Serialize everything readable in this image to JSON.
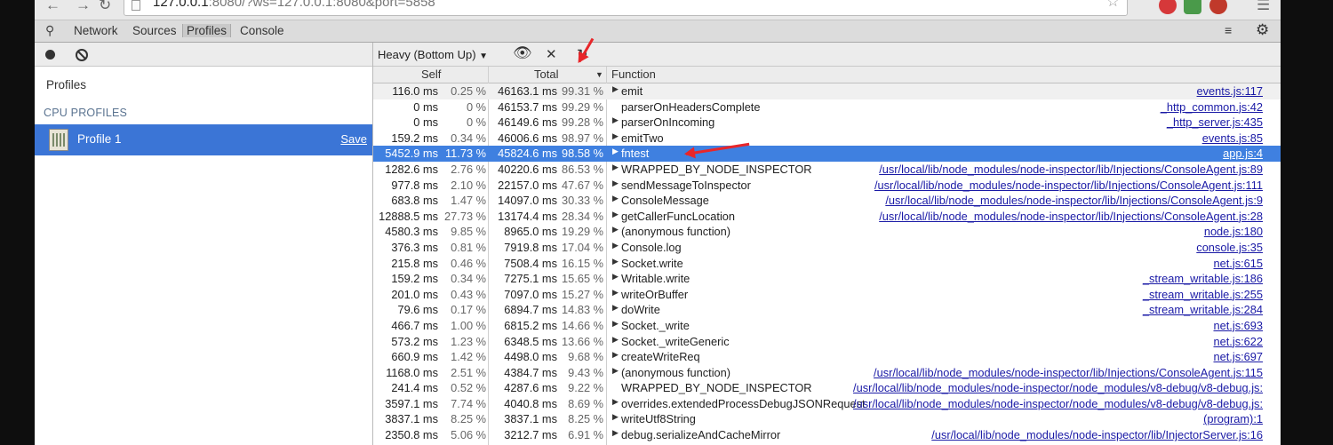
{
  "browser": {
    "url_prefix": "127.0.0.1",
    "url_rest": ":8080/?ws=127.0.0.1:8080&port=5858"
  },
  "devtools": {
    "tabs": [
      "Network",
      "Sources",
      "Profiles",
      "Console"
    ],
    "selected_tab": "Profiles"
  },
  "sidebar": {
    "title": "Profiles",
    "section": "CPU PROFILES",
    "profile_name": "Profile 1",
    "save_label": "Save"
  },
  "toolbar": {
    "view_mode": "Heavy (Bottom Up)"
  },
  "columns": {
    "self": "Self",
    "total": "Total",
    "function": "Function"
  },
  "rows": [
    {
      "self": "116.0 ms",
      "self_pct": "0.25 %",
      "total": "46163.1 ms",
      "total_pct": "99.31 %",
      "expand": true,
      "func": "emit",
      "url": "events.js:117"
    },
    {
      "self": "0 ms",
      "self_pct": "0 %",
      "total": "46153.7 ms",
      "total_pct": "99.29 %",
      "expand": false,
      "func": "parserOnHeadersComplete",
      "url": "_http_common.js:42"
    },
    {
      "self": "0 ms",
      "self_pct": "0 %",
      "total": "46149.6 ms",
      "total_pct": "99.28 %",
      "expand": true,
      "func": "parserOnIncoming",
      "url": "_http_server.js:435"
    },
    {
      "self": "159.2 ms",
      "self_pct": "0.34 %",
      "total": "46006.6 ms",
      "total_pct": "98.97 %",
      "expand": true,
      "func": "emitTwo",
      "url": "events.js:85"
    },
    {
      "self": "5452.9 ms",
      "self_pct": "11.73 %",
      "total": "45824.6 ms",
      "total_pct": "98.58 %",
      "expand": true,
      "func": "fntest",
      "url": "app.js:4",
      "selected": true
    },
    {
      "self": "1282.6 ms",
      "self_pct": "2.76 %",
      "total": "40220.6 ms",
      "total_pct": "86.53 %",
      "expand": true,
      "func": "WRAPPED_BY_NODE_INSPECTOR",
      "url": "/usr/local/lib/node_modules/node-inspector/lib/Injections/ConsoleAgent.js:89"
    },
    {
      "self": "977.8 ms",
      "self_pct": "2.10 %",
      "total": "22157.0 ms",
      "total_pct": "47.67 %",
      "expand": true,
      "func": "sendMessageToInspector",
      "url": "/usr/local/lib/node_modules/node-inspector/lib/Injections/ConsoleAgent.js:111"
    },
    {
      "self": "683.8 ms",
      "self_pct": "1.47 %",
      "total": "14097.0 ms",
      "total_pct": "30.33 %",
      "expand": true,
      "func": "ConsoleMessage",
      "url": "/usr/local/lib/node_modules/node-inspector/lib/Injections/ConsoleAgent.js:9"
    },
    {
      "self": "12888.5 ms",
      "self_pct": "27.73 %",
      "total": "13174.4 ms",
      "total_pct": "28.34 %",
      "expand": true,
      "func": "getCallerFuncLocation",
      "url": "/usr/local/lib/node_modules/node-inspector/lib/Injections/ConsoleAgent.js:28"
    },
    {
      "self": "4580.3 ms",
      "self_pct": "9.85 %",
      "total": "8965.0 ms",
      "total_pct": "19.29 %",
      "expand": true,
      "func": "(anonymous function)",
      "url": "node.js:180"
    },
    {
      "self": "376.3 ms",
      "self_pct": "0.81 %",
      "total": "7919.8 ms",
      "total_pct": "17.04 %",
      "expand": true,
      "func": "Console.log",
      "url": "console.js:35"
    },
    {
      "self": "215.8 ms",
      "self_pct": "0.46 %",
      "total": "7508.4 ms",
      "total_pct": "16.15 %",
      "expand": true,
      "func": "Socket.write",
      "url": "net.js:615"
    },
    {
      "self": "159.2 ms",
      "self_pct": "0.34 %",
      "total": "7275.1 ms",
      "total_pct": "15.65 %",
      "expand": true,
      "func": "Writable.write",
      "url": "_stream_writable.js:186"
    },
    {
      "self": "201.0 ms",
      "self_pct": "0.43 %",
      "total": "7097.0 ms",
      "total_pct": "15.27 %",
      "expand": true,
      "func": "writeOrBuffer",
      "url": "_stream_writable.js:255"
    },
    {
      "self": "79.6 ms",
      "self_pct": "0.17 %",
      "total": "6894.7 ms",
      "total_pct": "14.83 %",
      "expand": true,
      "func": "doWrite",
      "url": "_stream_writable.js:284"
    },
    {
      "self": "466.7 ms",
      "self_pct": "1.00 %",
      "total": "6815.2 ms",
      "total_pct": "14.66 %",
      "expand": true,
      "func": "Socket._write",
      "url": "net.js:693"
    },
    {
      "self": "573.2 ms",
      "self_pct": "1.23 %",
      "total": "6348.5 ms",
      "total_pct": "13.66 %",
      "expand": true,
      "func": "Socket._writeGeneric",
      "url": "net.js:622"
    },
    {
      "self": "660.9 ms",
      "self_pct": "1.42 %",
      "total": "4498.0 ms",
      "total_pct": "9.68 %",
      "expand": true,
      "func": "createWriteReq",
      "url": "net.js:697"
    },
    {
      "self": "1168.0 ms",
      "self_pct": "2.51 %",
      "total": "4384.7 ms",
      "total_pct": "9.43 %",
      "expand": true,
      "func": "(anonymous function)",
      "url": "/usr/local/lib/node_modules/node-inspector/lib/Injections/ConsoleAgent.js:115"
    },
    {
      "self": "241.4 ms",
      "self_pct": "0.52 %",
      "total": "4287.6 ms",
      "total_pct": "9.22 %",
      "expand": false,
      "func": "WRAPPED_BY_NODE_INSPECTOR",
      "url": "/usr/local/lib/node_modules/node-inspector/node_modules/v8-debug/v8-debug.js:"
    },
    {
      "self": "3597.1 ms",
      "self_pct": "7.74 %",
      "total": "4040.8 ms",
      "total_pct": "8.69 %",
      "expand": true,
      "func": "overrides.extendedProcessDebugJSONRequest",
      "url": "/usr/local/lib/node_modules/node-inspector/node_modules/v8-debug/v8-debug.js:"
    },
    {
      "self": "3837.1 ms",
      "self_pct": "8.25 %",
      "total": "3837.1 ms",
      "total_pct": "8.25 %",
      "expand": true,
      "func": "writeUtf8String",
      "url": "(program):1"
    },
    {
      "self": "2350.8 ms",
      "self_pct": "5.06 %",
      "total": "3212.7 ms",
      "total_pct": "6.91 %",
      "expand": true,
      "func": "debug.serializeAndCacheMirror",
      "url": "/usr/local/lib/node_modules/node-inspector/lib/InjectorServer.js:16"
    }
  ]
}
